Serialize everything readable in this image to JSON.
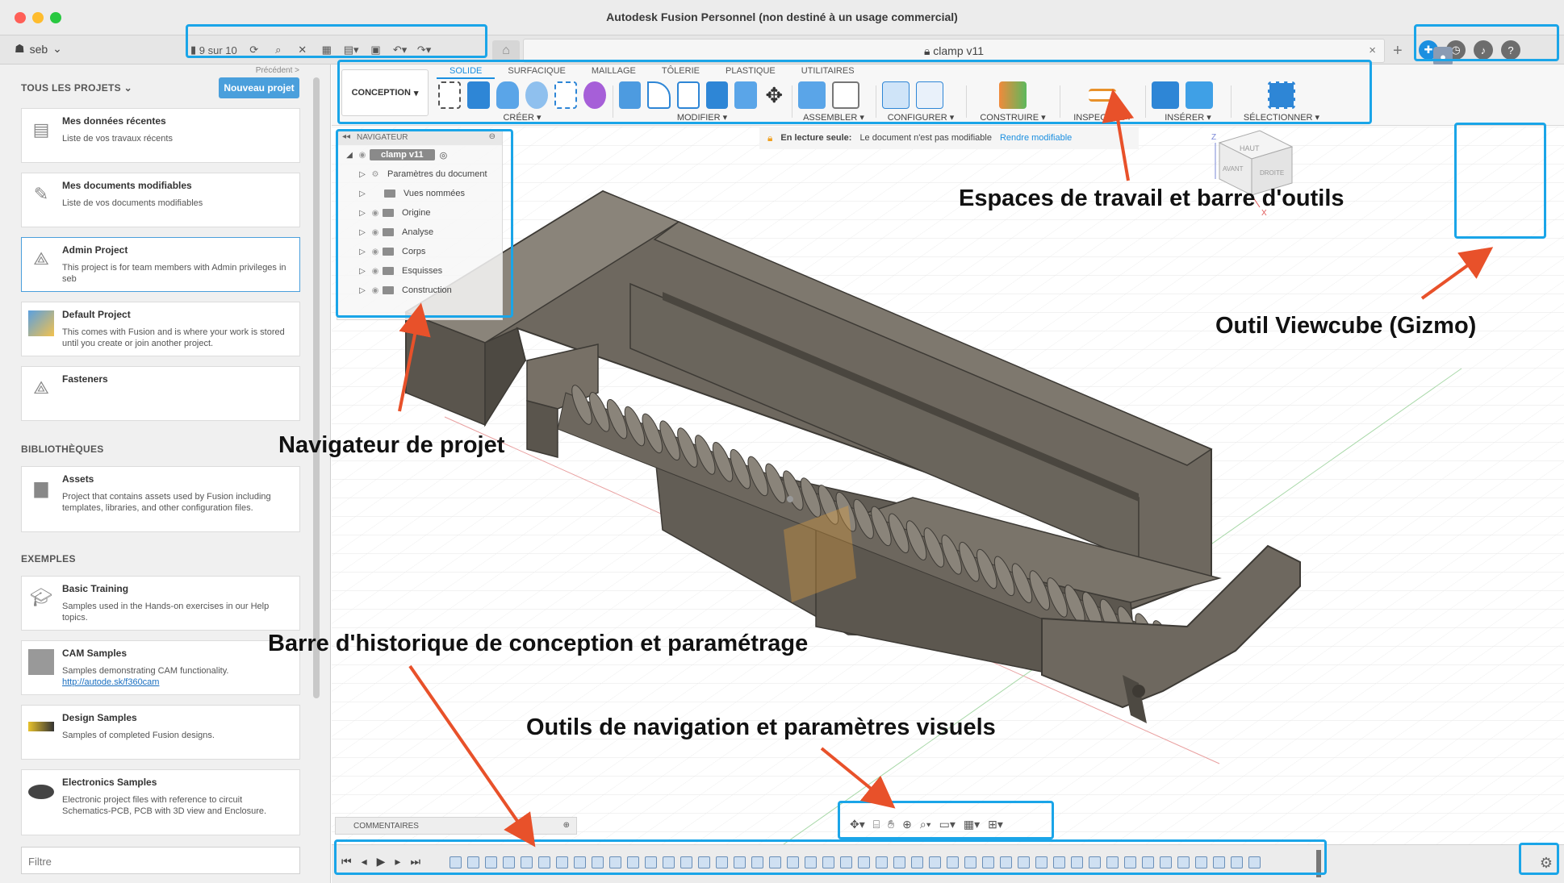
{
  "window": {
    "title": "Autodesk Fusion Personnel (non destiné à un usage commercial)"
  },
  "topbar": {
    "user": "seb",
    "version_count": "9 sur 10",
    "doc_tab": "clamp v11",
    "close": "×",
    "plus": "+"
  },
  "left_panel": {
    "previous": "Précédent >",
    "projects_title": "TOUS LES PROJETS",
    "new_project": "Nouveau projet",
    "projects": [
      {
        "title": "Mes données récentes",
        "desc": "Liste de vos travaux récents"
      },
      {
        "title": "Mes documents modifiables",
        "desc": "Liste de vos documents modifiables"
      },
      {
        "title": "Admin Project",
        "desc": "This project is for team members with Admin privileges in seb"
      },
      {
        "title": "Default Project",
        "desc": "This comes with Fusion and is where your work is stored until you create or join another project."
      },
      {
        "title": "Fasteners",
        "desc": ""
      }
    ],
    "libraries_title": "BIBLIOTHÈQUES",
    "libraries": [
      {
        "title": "Assets",
        "desc": "Project that contains assets used by Fusion including templates, libraries, and other configuration files."
      }
    ],
    "examples_title": "EXEMPLES",
    "examples": [
      {
        "title": "Basic Training",
        "desc": "Samples used in the Hands-on exercises in our Help topics."
      },
      {
        "title": "CAM Samples",
        "desc": "Samples demonstrating CAM functionality.",
        "link": "http://autode.sk/f360cam"
      },
      {
        "title": "Design Samples",
        "desc": "Samples of completed Fusion designs."
      },
      {
        "title": "Electronics Samples",
        "desc": "Electronic project files with reference to circuit Schematics-PCB, PCB with 3D view and Enclosure."
      }
    ],
    "filter_placeholder": "Filtre"
  },
  "toolbar": {
    "workspace": "CONCEPTION",
    "tabs": [
      "SOLIDE",
      "SURFACIQUE",
      "MAILLAGE",
      "TÔLERIE",
      "PLASTIQUE",
      "UTILITAIRES"
    ],
    "groups": [
      "CRÉER ▾",
      "MODIFIER ▾",
      "ASSEMBLER ▾",
      "CONFIGURER ▾",
      "CONSTRUIRE ▾",
      "INSPECTER ▾",
      "INSÉRER ▾",
      "SÉLECTIONNER ▾"
    ]
  },
  "navigator": {
    "title": "NAVIGATEUR",
    "root": "clamp v11",
    "items": [
      "Paramètres du document",
      "Vues nommées",
      "Origine",
      "Analyse",
      "Corps",
      "Esquisses",
      "Construction"
    ]
  },
  "readonly_bar": {
    "label": "En lecture seule:",
    "message": "Le document n'est pas modifiable",
    "action": "Rendre modifiable"
  },
  "comments": "COMMENTAIRES",
  "viewcube": {
    "top": "HAUT",
    "front": "AVANT",
    "right": "DROITE",
    "z": "Z",
    "x": "X"
  },
  "annotations": {
    "toolbar": "Espaces de travail et barre d'outils",
    "viewcube": "Outil Viewcube (Gizmo)",
    "navigator": "Navigateur de projet",
    "history": "Barre d'historique de conception et paramétrage",
    "navtools": "Outils de navigation et paramètres visuels"
  },
  "colors": {
    "highlight": "#1aa5e8",
    "arrow": "#e8512a",
    "accent": "#1b8fe0",
    "model": "#6b655c"
  }
}
